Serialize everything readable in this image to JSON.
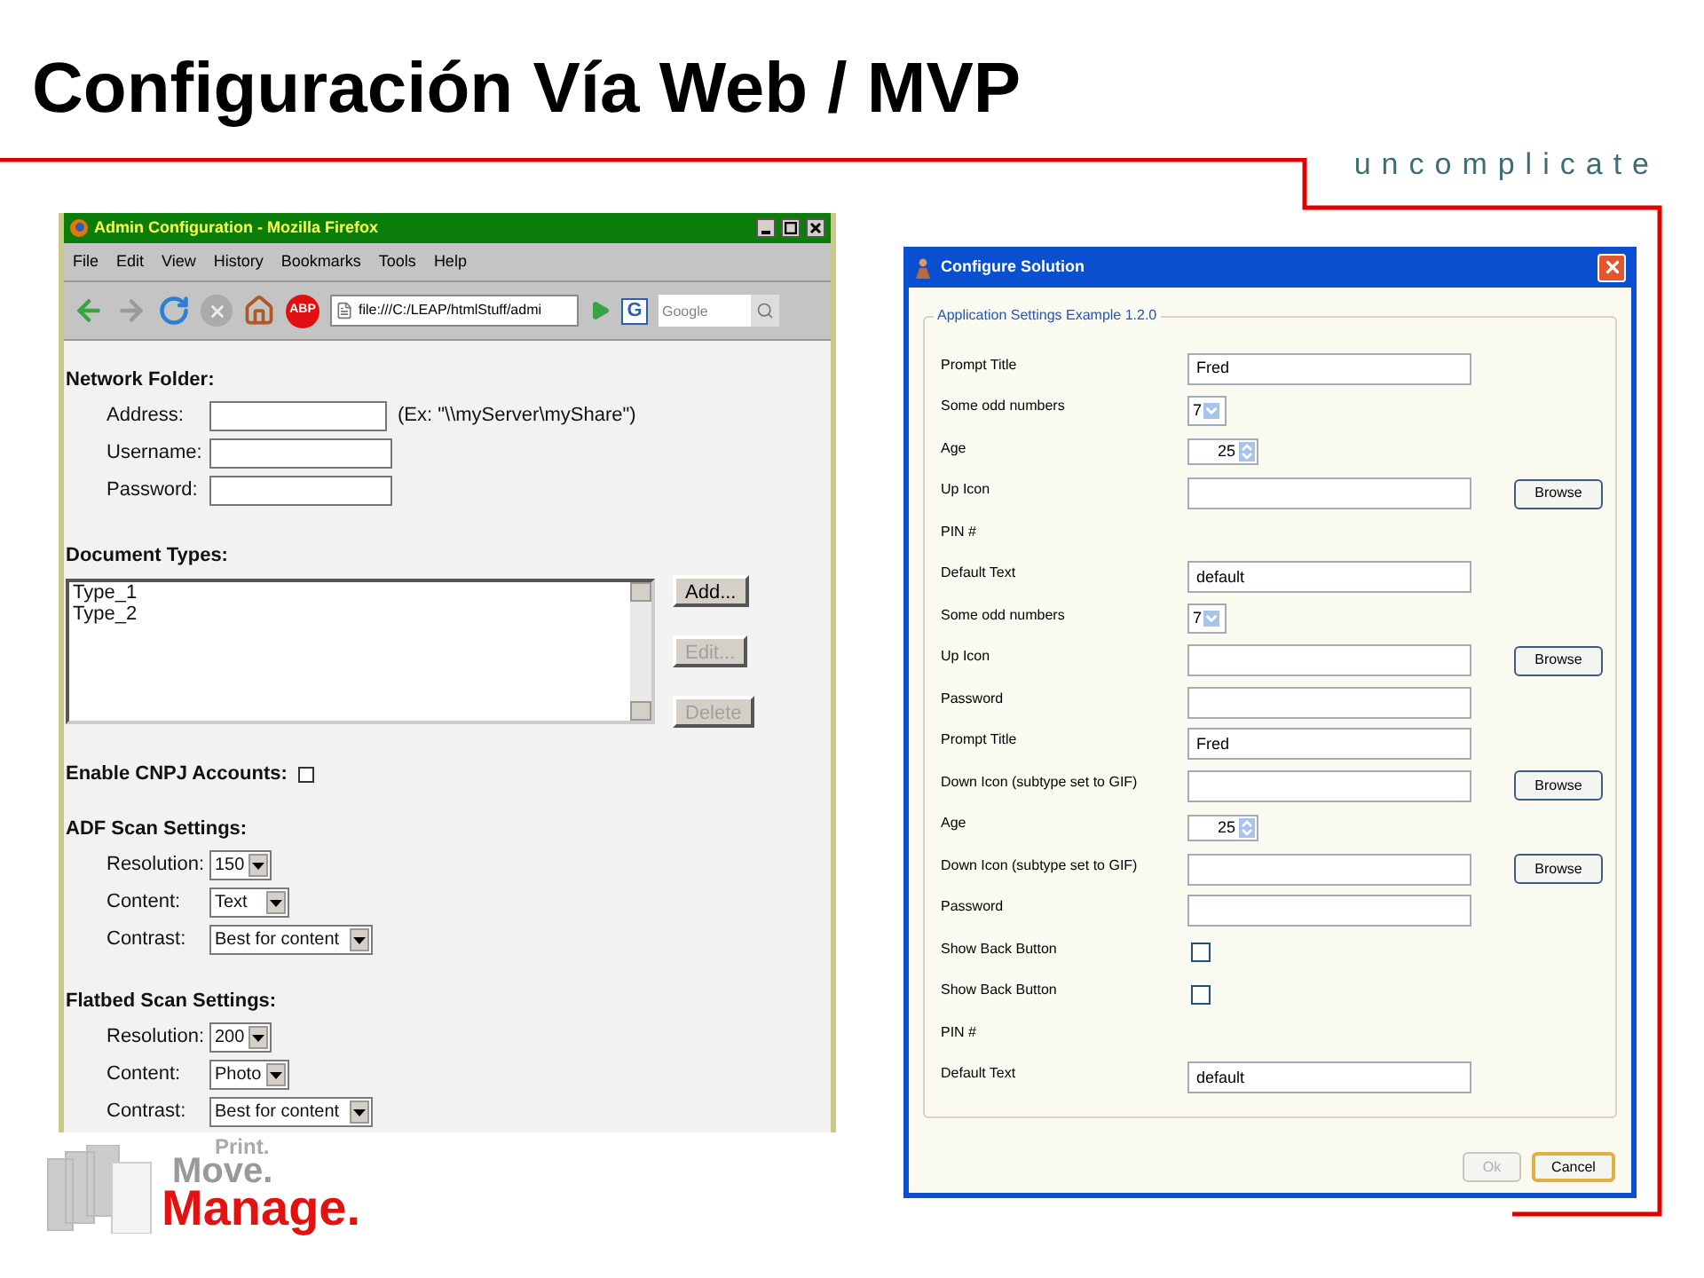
{
  "slide_title": "Configuración Vía Web / MVP",
  "tagline": "uncomplicate",
  "browser": {
    "title": "Admin Configuration - Mozilla Firefox",
    "menu": [
      "File",
      "Edit",
      "View",
      "History",
      "Bookmarks",
      "Tools",
      "Help"
    ],
    "adblock_badge": "ABP",
    "address": "file:///C:/LEAP/htmlStuff/admi",
    "search_engine_letter": "G",
    "search_placeholder": "Google",
    "network_folder": {
      "heading": "Network Folder:",
      "fields": [
        {
          "label": "Address:",
          "hint": "(Ex: \"\\\\myServer\\myShare\")"
        },
        {
          "label": "Username:"
        },
        {
          "label": "Password:"
        }
      ]
    },
    "document_types": {
      "heading": "Document Types:",
      "items": [
        "Type_1",
        "Type_2"
      ],
      "buttons": [
        {
          "label": "Add...",
          "disabled": false
        },
        {
          "label": "Edit...",
          "disabled": true
        },
        {
          "label": "Delete",
          "disabled": true
        }
      ]
    },
    "cnpj": {
      "label": "Enable CNPJ Accounts:",
      "checked": false
    },
    "scan_sections": [
      {
        "heading": "ADF Scan Settings:",
        "settings": [
          {
            "label": "Resolution:",
            "value": "150"
          },
          {
            "label": "Content:",
            "value": "Text"
          },
          {
            "label": "Contrast:",
            "value": "Best for content"
          }
        ]
      },
      {
        "heading": "Flatbed Scan Settings:",
        "settings": [
          {
            "label": "Resolution:",
            "value": "200"
          },
          {
            "label": "Content:",
            "value": "Photo"
          },
          {
            "label": "Contrast:",
            "value": "Best for content"
          }
        ]
      }
    ]
  },
  "dialog": {
    "title": "Configure Solution",
    "group": "Application Settings Example 1.2.0",
    "rows": [
      {
        "kind": "text",
        "label": "Prompt Title",
        "value": "Fred"
      },
      {
        "kind": "select",
        "label": "Some odd numbers",
        "value": "7"
      },
      {
        "kind": "spinner",
        "label": "Age",
        "value": "25"
      },
      {
        "kind": "file",
        "label": "Up Icon",
        "button": "Browse"
      },
      {
        "kind": "label",
        "label": "PIN #"
      },
      {
        "kind": "text",
        "label": "Default Text",
        "value": "default"
      },
      {
        "kind": "select",
        "label": "Some odd numbers",
        "value": "7"
      },
      {
        "kind": "file",
        "label": "Up Icon",
        "button": "Browse"
      },
      {
        "kind": "text",
        "label": "Password"
      },
      {
        "kind": "text",
        "label": "Prompt Title",
        "value": "Fred"
      },
      {
        "kind": "file",
        "label": "Down Icon (subtype set to GIF)",
        "button": "Browse"
      },
      {
        "kind": "spinner",
        "label": "Age",
        "value": "25"
      },
      {
        "kind": "file",
        "label": "Down Icon (subtype set to GIF)",
        "button": "Browse"
      },
      {
        "kind": "text",
        "label": "Password"
      },
      {
        "kind": "checkbox",
        "label": "Show Back Button",
        "checked": false
      },
      {
        "kind": "checkbox",
        "label": "Show Back Button",
        "checked": false
      },
      {
        "kind": "label",
        "label": "PIN #"
      },
      {
        "kind": "text",
        "label": "Default Text",
        "value": "default"
      }
    ],
    "buttons": [
      {
        "label": "Ok",
        "disabled": true
      },
      {
        "label": "Cancel",
        "disabled": false
      }
    ]
  },
  "logo": {
    "line1": "Print.",
    "line2": "Move.",
    "line3": "Manage."
  }
}
